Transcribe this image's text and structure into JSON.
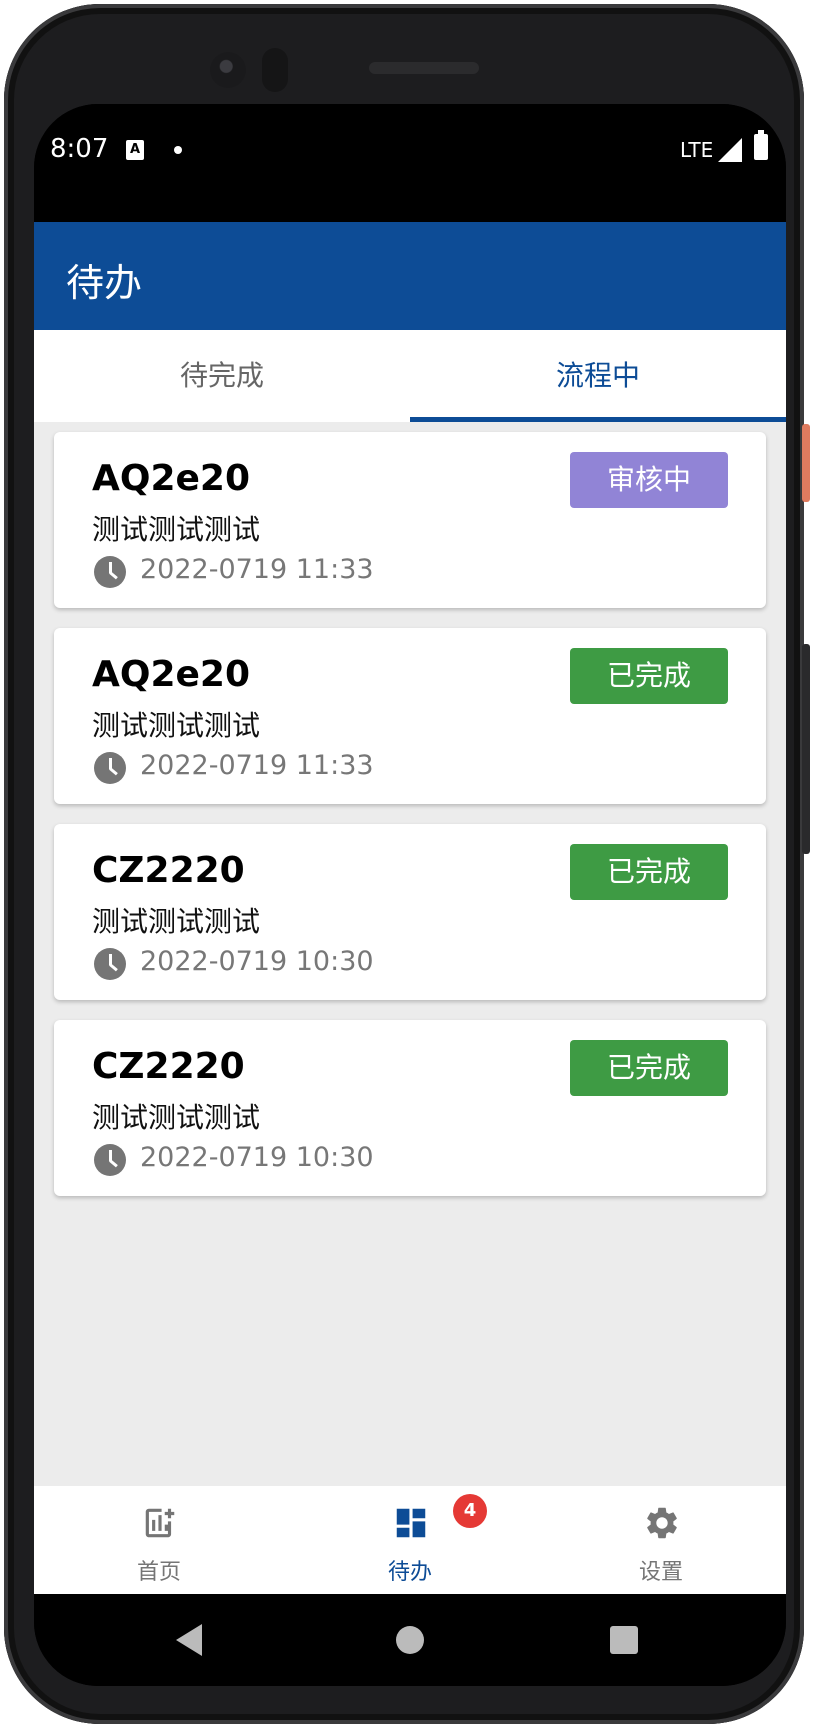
{
  "status_bar": {
    "time": "8:07",
    "network": "LTE"
  },
  "app_bar": {
    "title": "待办"
  },
  "tabs": [
    {
      "label": "待完成",
      "selected": false
    },
    {
      "label": "流程中",
      "selected": true
    }
  ],
  "cards": [
    {
      "title": "AQ2e20",
      "description": "测试测试测试",
      "time": "2022-0719 11:33",
      "status": "审核中",
      "status_color": "#9184d6"
    },
    {
      "title": "AQ2e20",
      "description": "测试测试测试",
      "time": "2022-0719 11:33",
      "status": "已完成",
      "status_color": "#3e9b44"
    },
    {
      "title": "CZ2220",
      "description": "测试测试测试",
      "time": "2022-0719 10:30",
      "status": "已完成",
      "status_color": "#3e9b44"
    },
    {
      "title": "CZ2220",
      "description": "测试测试测试",
      "time": "2022-0719 10:30",
      "status": "已完成",
      "status_color": "#3e9b44"
    }
  ],
  "bottom_nav": [
    {
      "label": "首页",
      "icon": "chart-add-icon",
      "selected": false
    },
    {
      "label": "待办",
      "icon": "dashboard-icon",
      "selected": true,
      "badge": "4"
    },
    {
      "label": "设置",
      "icon": "gear-icon",
      "selected": false
    }
  ],
  "colors": {
    "primary": "#0d4c96",
    "inactive": "#757575"
  }
}
